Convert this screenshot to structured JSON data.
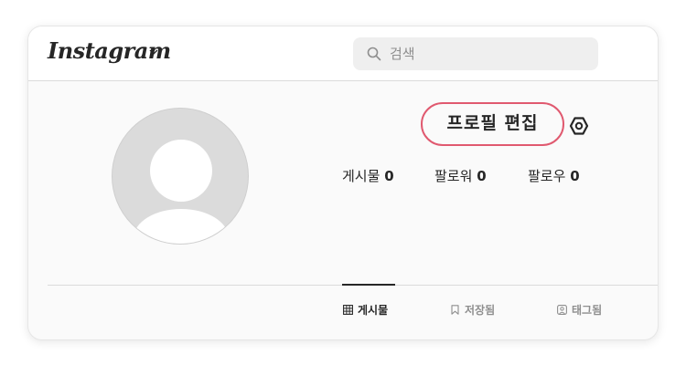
{
  "header": {
    "logo": "Instagram",
    "search": {
      "placeholder": "검색",
      "value": ""
    }
  },
  "profile": {
    "edit_button": "프로필 편집",
    "stats": [
      {
        "label": "게시물",
        "count": "0"
      },
      {
        "label": "팔로워",
        "count": "0"
      },
      {
        "label": "팔로우",
        "count": "0"
      }
    ]
  },
  "tabs": [
    {
      "label": "게시물",
      "icon": "grid-icon",
      "active": true
    },
    {
      "label": "저장됨",
      "icon": "bookmark-icon",
      "active": false
    },
    {
      "label": "태그됨",
      "icon": "tagged-icon",
      "active": false
    }
  ],
  "colors": {
    "accent_outline": "#e0596f",
    "text": "#262626",
    "muted": "#8e8e8e",
    "avatar_bg": "#dbdbdb"
  }
}
